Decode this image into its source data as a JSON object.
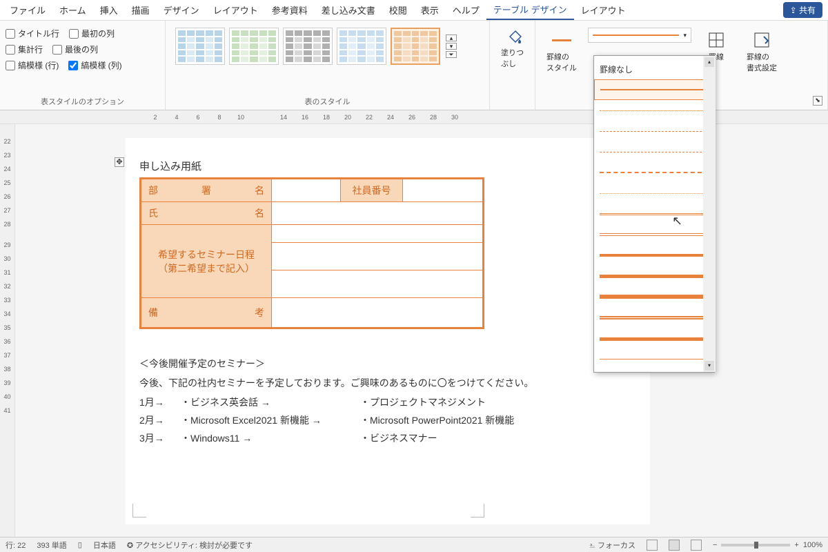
{
  "menu": {
    "items": [
      "ファイル",
      "ホーム",
      "挿入",
      "描画",
      "デザイン",
      "レイアウト",
      "参考資料",
      "差し込み文書",
      "校閲",
      "表示",
      "ヘルプ",
      "テーブル デザイン",
      "レイアウト"
    ],
    "active": 11,
    "share": "共有"
  },
  "ribbon": {
    "options": {
      "label": "表スタイルのオプション",
      "cb": [
        {
          "label": "タイトル行",
          "checked": false
        },
        {
          "label": "最初の列",
          "checked": false
        },
        {
          "label": "集計行",
          "checked": false
        },
        {
          "label": "最後の列",
          "checked": false
        },
        {
          "label": "縞模様 (行)",
          "checked": false
        },
        {
          "label": "縞模様 (列)",
          "checked": true
        }
      ]
    },
    "styles": {
      "label": "表のスタイル"
    },
    "fill": {
      "label": "塗りつぶし"
    },
    "border_style": {
      "label": "罫線の\nスタイル"
    },
    "borders": {
      "label": "罫線"
    },
    "border_format": {
      "label": "罫線の\n書式設定"
    }
  },
  "dropdown": {
    "no_border": "罫線なし",
    "styles": [
      {
        "css": "border-top:2px solid #e8813c",
        "sel": true
      },
      {
        "css": "border-top:1px dotted #e8813c"
      },
      {
        "css": "border-top:1px dashed #e8813c"
      },
      {
        "css": "border-top:1px dashed #e8813c;border-top-style:dashed"
      },
      {
        "css": "border-top:2px dashed #e8813c"
      },
      {
        "css": "border-top:1px dotted #e8813c;opacity:.7"
      },
      {
        "css": "border-top:3px double #e8813c"
      },
      {
        "css": "border-top:4px double #e8813c"
      },
      {
        "css": "border-top:4px solid #e8813c"
      },
      {
        "css": "border-top:5px solid #e8813c"
      },
      {
        "css": "border-top:6px solid #e8813c"
      },
      {
        "css": "border-top:5px double #e8813c"
      },
      {
        "css": "border-top:3px solid #e8813c;box-shadow:0 2px #e8813c"
      },
      {
        "css": "border-top:1px solid #e8813c"
      }
    ]
  },
  "ruler_h": [
    "2",
    "4",
    "6",
    "8",
    "10",
    "",
    "14",
    "16",
    "18",
    "20",
    "22",
    "24",
    "26",
    "28",
    "30"
  ],
  "ruler_v": [
    "22",
    "23",
    "24",
    "25",
    "26",
    "27",
    "28",
    "",
    "29",
    "30",
    "31",
    "32",
    "33",
    "34",
    "35",
    "36",
    "37",
    "38",
    "39",
    "40",
    "41"
  ],
  "doc": {
    "title": "申し込み用紙",
    "rows": {
      "dept": "部　　署　　名",
      "emp": "社員番号",
      "name": "氏　　　　　名",
      "sem": "希望するセミナー日程\n（第二希望まで記入）",
      "note": "備　　　　　考"
    },
    "sem_title": "＜今後開催予定のセミナー＞",
    "sem_desc": "今後、下記の社内セミナーを予定しております。ご興味のあるものに〇をつけてください。",
    "sem_list": [
      {
        "m": "1月→",
        "s1": "・ビジネス英会話",
        "s2": "・プロジェクトマネジメント"
      },
      {
        "m": "2月→",
        "s1": "・Microsoft Excel2021 新機能",
        "s2": "・Microsoft PowerPoint2021 新機能"
      },
      {
        "m": "3月→",
        "s1": "・Windows11",
        "s2": "・ビジネスマナー"
      }
    ]
  },
  "status": {
    "line": "行: 22",
    "words": "393 単語",
    "lang": "日本語",
    "acc": "アクセシビリティ: 検討が必要です",
    "focus": "フォーカス",
    "zoom": "100%"
  }
}
